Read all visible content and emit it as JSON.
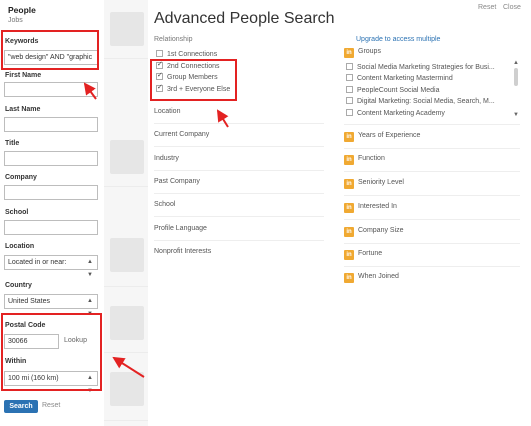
{
  "left_panel": {
    "title": "People",
    "jobs_link": "Jobs",
    "keywords": {
      "label": "Keywords",
      "value": "\"web design\" AND \"graphic"
    },
    "first_name": {
      "label": "First Name",
      "value": ""
    },
    "last_name": {
      "label": "Last Name",
      "value": ""
    },
    "title_field": {
      "label": "Title",
      "value": ""
    },
    "company": {
      "label": "Company",
      "value": ""
    },
    "school": {
      "label": "School",
      "value": ""
    },
    "location": {
      "label": "Location",
      "value": "Located in or near:"
    },
    "country": {
      "label": "Country",
      "value": "United States"
    },
    "postal_code": {
      "label": "Postal Code",
      "value": "30066",
      "lookup": "Lookup"
    },
    "within": {
      "label": "Within",
      "value": "100 mi (160 km)"
    },
    "search_button": "Search",
    "reset_link": "Reset"
  },
  "modal": {
    "title": "Advanced People Search",
    "reset": "Reset",
    "close": "Close",
    "relationship": {
      "label": "Relationship",
      "options": [
        {
          "label": "1st Connections",
          "checked": false
        },
        {
          "label": "2nd Connections",
          "checked": true
        },
        {
          "label": "Group Members",
          "checked": true
        },
        {
          "label": "3rd + Everyone Else",
          "checked": true
        }
      ]
    },
    "facets": [
      "Location",
      "Current Company",
      "Industry",
      "Past Company",
      "School",
      "Profile Language",
      "Nonprofit Interests"
    ],
    "upgrade_link": "Upgrade to access multiple",
    "premium_badge": "in",
    "groups": {
      "label": "Groups",
      "items": [
        "Social Media Marketing Strategies for Busi...",
        "Content Marketing Mastermind",
        "PeopleCount Social Media",
        "Digital Marketing: Social Media, Search, M...",
        "Content Marketing Academy"
      ]
    },
    "premium_facets": [
      "Years of Experience",
      "Function",
      "Seniority Level",
      "Interested In",
      "Company Size",
      "Fortune",
      "When Joined"
    ]
  },
  "colors": {
    "accent": "#2b72b3",
    "highlight": "#e32222",
    "premium": "#f0a932"
  },
  "icons": {
    "checkbox": "checkbox-icon",
    "premium": "linkedin-in-icon",
    "select": "chevron-updown-icon"
  }
}
